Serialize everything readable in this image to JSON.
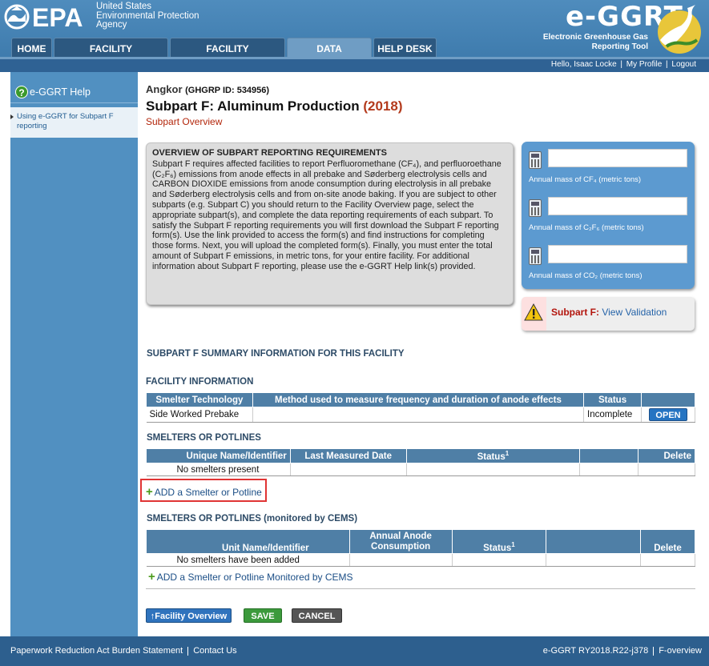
{
  "header": {
    "agency_lines": [
      "United States",
      "Environmental Protection",
      "Agency"
    ],
    "epa": "EPA",
    "product_title": "e-GGRT",
    "product_subtitle": "Electronic Greenhouse Gas Reporting Tool"
  },
  "nav": {
    "tabs": [
      {
        "label": "HOME",
        "active": false
      },
      {
        "label": "FACILITY REGISTRATION",
        "active": false
      },
      {
        "label": "FACILITY MANAGEMENT",
        "active": false
      },
      {
        "label": "DATA REPORTING",
        "active": true
      },
      {
        "label": "HELP DESK",
        "active": false
      }
    ]
  },
  "userbar": {
    "greeting": "Hello, Isaac Locke",
    "my_profile": "My Profile",
    "logout": "Logout"
  },
  "sidebar": {
    "help_title": "e-GGRT Help",
    "help_link": "Using e-GGRT for Subpart F reporting"
  },
  "page": {
    "facility": "Angkor",
    "ghgrp_id": "(GHGRP ID: 534956)",
    "title": "Subpart F: Aluminum Production",
    "year": "(2018)",
    "subtitle": "Subpart Overview"
  },
  "overview": {
    "heading": "OVERVIEW OF SUBPART REPORTING REQUIREMENTS",
    "text": "Subpart F requires affected facilities to report Perfluoromethane (CF₄), and perfluoroethane (C₂F₆) emissions from anode effects in all prebake and Søderberg electrolysis cells and CARBON DIOXIDE emissions from anode consumption during electrolysis in all prebake and Søderberg electrolysis cells and from on-site anode baking. If you are subject to other subparts (e.g. Subpart C) you should return to the Facility Overview page, select the appropriate subpart(s), and complete the data reporting requirements of each subpart. To satisfy the Subpart F reporting requirements you will first download the Subpart F reporting form(s). Use the link provided to access the form(s) and find instructions for completing those forms. Next, you will upload the completed form(s). Finally, you must enter the total amount of Subpart F emissions, in metric tons, for your entire facility. For additional information about Subpart F reporting, please use the e-GGRT Help link(s) provided."
  },
  "mass": {
    "cf4_label": "Annual mass of CF₄ (metric tons)",
    "c2f6_label": "Annual mass of C₂F₆ (metric tons)",
    "co2_label": "Annual mass of CO₂ (metric tons)",
    "cf4_value": "",
    "c2f6_value": "",
    "co2_value": ""
  },
  "validation": {
    "label": "Subpart F:",
    "link": "View Validation"
  },
  "summary": {
    "heading": "SUBPART F SUMMARY INFORMATION FOR THIS FACILITY"
  },
  "facility_info": {
    "heading": "FACILITY INFORMATION",
    "columns": [
      "Smelter Technology",
      "Method used to measure frequency and duration of anode effects",
      "Status",
      ""
    ],
    "row": {
      "technology": "Side Worked Prebake",
      "method": "",
      "status": "Incomplete",
      "action": "OPEN"
    }
  },
  "smelters": {
    "heading": "SMELTERS OR POTLINES",
    "columns": [
      "Unique Name/Identifier",
      "Last Measured Date",
      "Status",
      "",
      "Delete"
    ],
    "status_sup": "1",
    "empty": "No smelters present",
    "add_link": "ADD a Smelter or Potline"
  },
  "cems": {
    "heading": "SMELTERS OR POTLINES (monitored by CEMS)",
    "columns": [
      "Unit Name/Identifier",
      "Annual Anode Consumption",
      "Status",
      "",
      "Delete"
    ],
    "status_sup": "1",
    "empty": "No smelters have been added",
    "add_link": "ADD a Smelter or Potline Monitored by CEMS"
  },
  "buttons": {
    "facility_overview": "Facility Overview",
    "save": "SAVE",
    "cancel": "CANCEL"
  },
  "footer": {
    "paperwork": "Paperwork Reduction Act Burden Statement",
    "contact": "Contact Us",
    "version": "e-GGRT RY2018.R22-j378",
    "page_id": "F-overview"
  },
  "colors": {
    "header_blue": "#3f7cae",
    "sidebar_blue": "#5190c1",
    "table_header": "#4f7fa6",
    "accent_red": "#b33a1c",
    "save_green": "#3c9a3c"
  }
}
